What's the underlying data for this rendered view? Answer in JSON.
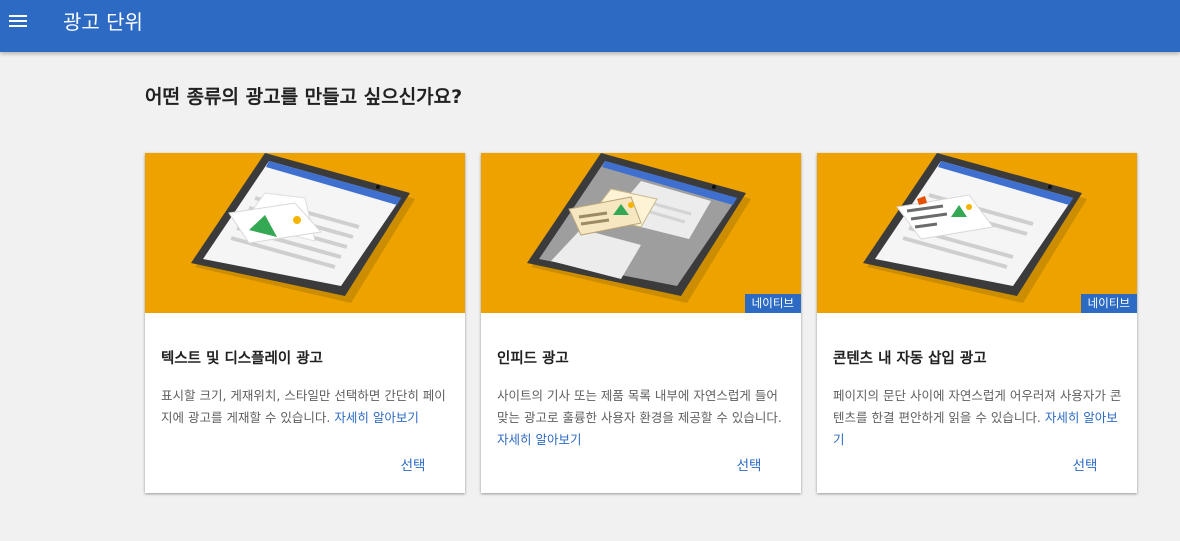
{
  "appbar": {
    "title": "광고 단위",
    "menu_icon": "menu-icon"
  },
  "heading": "어떤 종류의 광고를 만들고 싶으신가요?",
  "colors": {
    "appbar": "#2d6ac4",
    "hero": "#eea200",
    "link": "#2d6ac4"
  },
  "cards": [
    {
      "title": "텍스트 및 디스플레이 광고",
      "description": "표시할 크기, 게재위치, 스타일만 선택하면 간단히 페이지에 광고를 게재할 수 있습니다.",
      "link": "자세히 알아보기",
      "select": "선택",
      "badge": ""
    },
    {
      "title": "인피드 광고",
      "description": "사이트의 기사 또는 제품 목록 내부에 자연스럽게 들어맞는 광고로 훌륭한 사용자 환경을 제공할 수 있습니다.",
      "link": "자세히 알아보기",
      "select": "선택",
      "badge": "네이티브"
    },
    {
      "title": "콘텐츠 내 자동 삽입 광고",
      "description": "페이지의 문단 사이에 자연스럽게 어우러져 사용자가 콘텐츠를 한결 편안하게 읽을 수 있습니다.",
      "link": "자세히 알아보기",
      "select": "선택",
      "badge": "네이티브"
    }
  ]
}
